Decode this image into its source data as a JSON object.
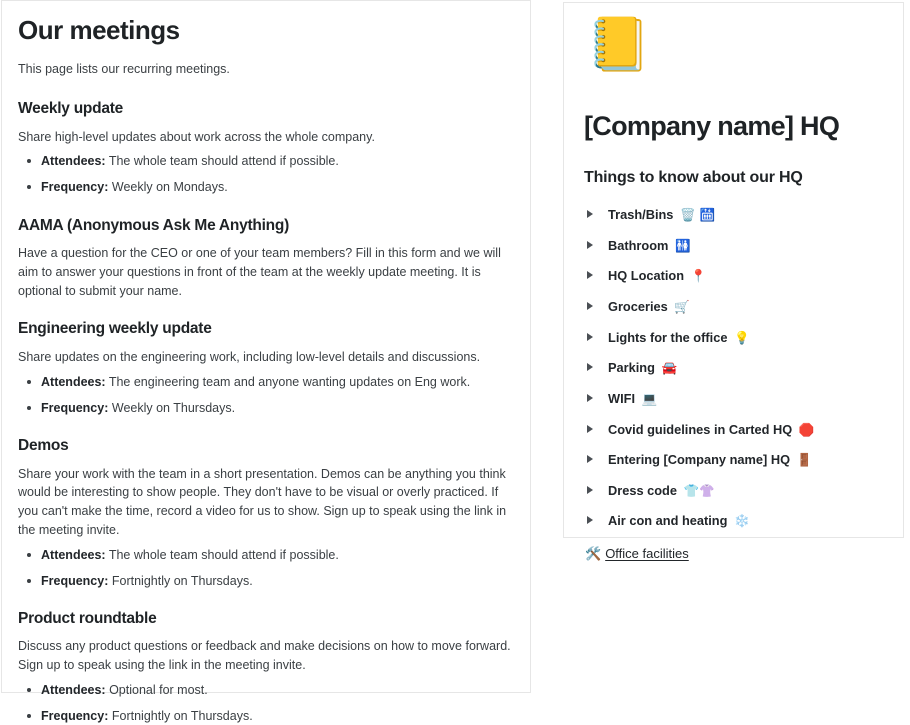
{
  "meetings": {
    "title": "Our meetings",
    "intro": "This page lists our recurring meetings.",
    "fact_labels": {
      "attendees": "Attendees:",
      "frequency": "Frequency:"
    },
    "sections": [
      {
        "heading": "Weekly update",
        "body": "Share high-level updates about work across the whole company.",
        "attendees": "The whole team should attend if possible.",
        "frequency": "Weekly on Mondays."
      },
      {
        "heading": "AAMA (Anonymous Ask Me Anything)",
        "body": "Have a question for the CEO or one of your team members? Fill in this form and we will aim to answer your questions in front of the team at the weekly update meeting.  It is optional to submit your name.",
        "attendees": "",
        "frequency": ""
      },
      {
        "heading": "Engineering weekly update",
        "body": "Share updates on the engineering work, including low-level details and discussions.",
        "attendees": "The engineering team and anyone wanting updates on Eng work.",
        "frequency": "Weekly on Thursdays."
      },
      {
        "heading": "Demos",
        "body": "Share your work with the team in a short presentation. Demos can be anything you think would be interesting to show people. They don't have to be visual or overly practiced. If you can't make the time, record a video for us to show. Sign up to speak using the link in the meeting invite.",
        "attendees": "The whole team should attend if possible.",
        "frequency": "Fortnightly on Thursdays."
      },
      {
        "heading": "Product roundtable",
        "body": "Discuss any product questions or feedback and make decisions on how to move forward. Sign up to speak using the link in the meeting invite.",
        "attendees": "Optional for most.",
        "frequency": "Fortnightly on Thursdays."
      }
    ]
  },
  "hq": {
    "page_icon": "📒",
    "page_icon_name": "ledger-icon",
    "title": "[Company name] HQ",
    "subtitle": "Things to know about our HQ",
    "toggles": [
      {
        "label": "Trash/Bins",
        "emoji": "🗑️ 🛗"
      },
      {
        "label": "Bathroom",
        "emoji": "🚻"
      },
      {
        "label": "HQ Location",
        "emoji": "📍"
      },
      {
        "label": "Groceries",
        "emoji": "🛒"
      },
      {
        "label": "Lights for the office",
        "emoji": "💡"
      },
      {
        "label": "Parking",
        "emoji": "🚘"
      },
      {
        "label": "WIFI",
        "emoji": "💻"
      },
      {
        "label": "Covid guidelines in Carted HQ",
        "emoji": "🛑"
      },
      {
        "label": "Entering [Company name] HQ",
        "emoji": "🚪"
      },
      {
        "label": "Dress code",
        "emoji": "👕👚"
      },
      {
        "label": "Air con and heating",
        "emoji": "❄️"
      }
    ],
    "facilities": {
      "icon": "🛠️",
      "label": "Office facilities"
    }
  },
  "colors": {
    "text": "#2f3437",
    "heading": "#1f2326",
    "border": "#e6e6e6",
    "background": "#ffffff"
  }
}
